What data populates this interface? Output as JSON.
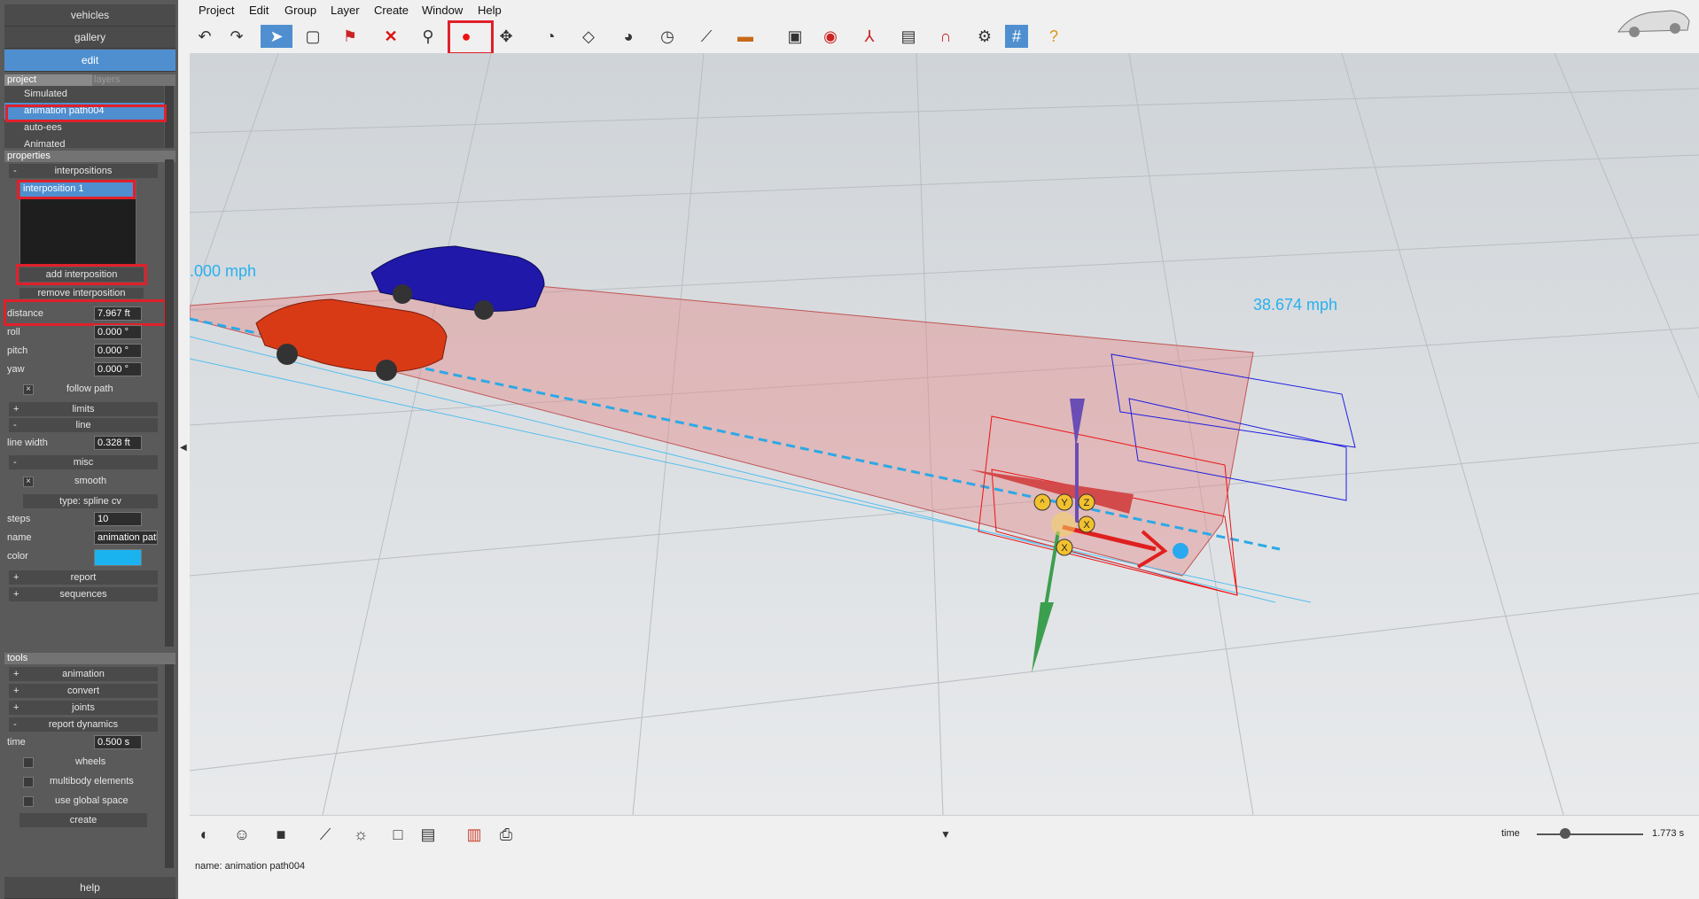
{
  "sidebar": {
    "top_buttons": [
      "vehicles",
      "gallery",
      "edit"
    ],
    "tabs": [
      "project",
      "layers"
    ],
    "project_items": [
      "Simulated",
      "animation path004",
      "auto-ees",
      "Animated"
    ],
    "properties_header": "properties",
    "interpositions_group": "interpositions",
    "interposition_list": [
      "interposition 1"
    ],
    "add_interposition": "add interposition",
    "remove_interposition": "remove interposition",
    "distance_label": "distance",
    "distance_value": "7.967 ft",
    "roll_label": "roll",
    "roll_value": "0.000 °",
    "pitch_label": "pitch",
    "pitch_value": "0.000 °",
    "yaw_label": "yaw",
    "yaw_value": "0.000 °",
    "follow_path_label": "follow path",
    "limits_group": "limits",
    "line_group": "line",
    "line_width_label": "line width",
    "line_width_value": "0.328 ft",
    "misc_group": "misc",
    "smooth_label": "smooth",
    "type_button": "type: spline cv",
    "steps_label": "steps",
    "steps_value": "10",
    "name_label": "name",
    "name_value": "animation path",
    "color_label": "color",
    "color_value": "#1ab3f0",
    "report_group": "report",
    "sequences_group": "sequences",
    "tools_header": "tools",
    "tools_groups": [
      "animation",
      "convert",
      "joints",
      "report dynamics"
    ],
    "time_label": "time",
    "time_value": "0.500 s",
    "wheels_label": "wheels",
    "multibody_label": "multibody elements",
    "global_space_label": "use global space",
    "create_button": "create",
    "help_button": "help"
  },
  "menubar": [
    "Project",
    "Edit",
    "Group",
    "Layer",
    "Create",
    "Window",
    "Help"
  ],
  "viewport": {
    "speed_left": ".000 mph",
    "speed_right": "38.674 mph",
    "gizmo_labels": [
      "^",
      "Y",
      "Z",
      "X",
      "X"
    ]
  },
  "bottom": {
    "time_label": "time",
    "time_value": "1.773 s",
    "status_text": "name: animation path004"
  },
  "colors": {
    "accent": "#4f8fd0",
    "highlight": "#e0202a",
    "path_cyan": "#1ab3f0"
  }
}
